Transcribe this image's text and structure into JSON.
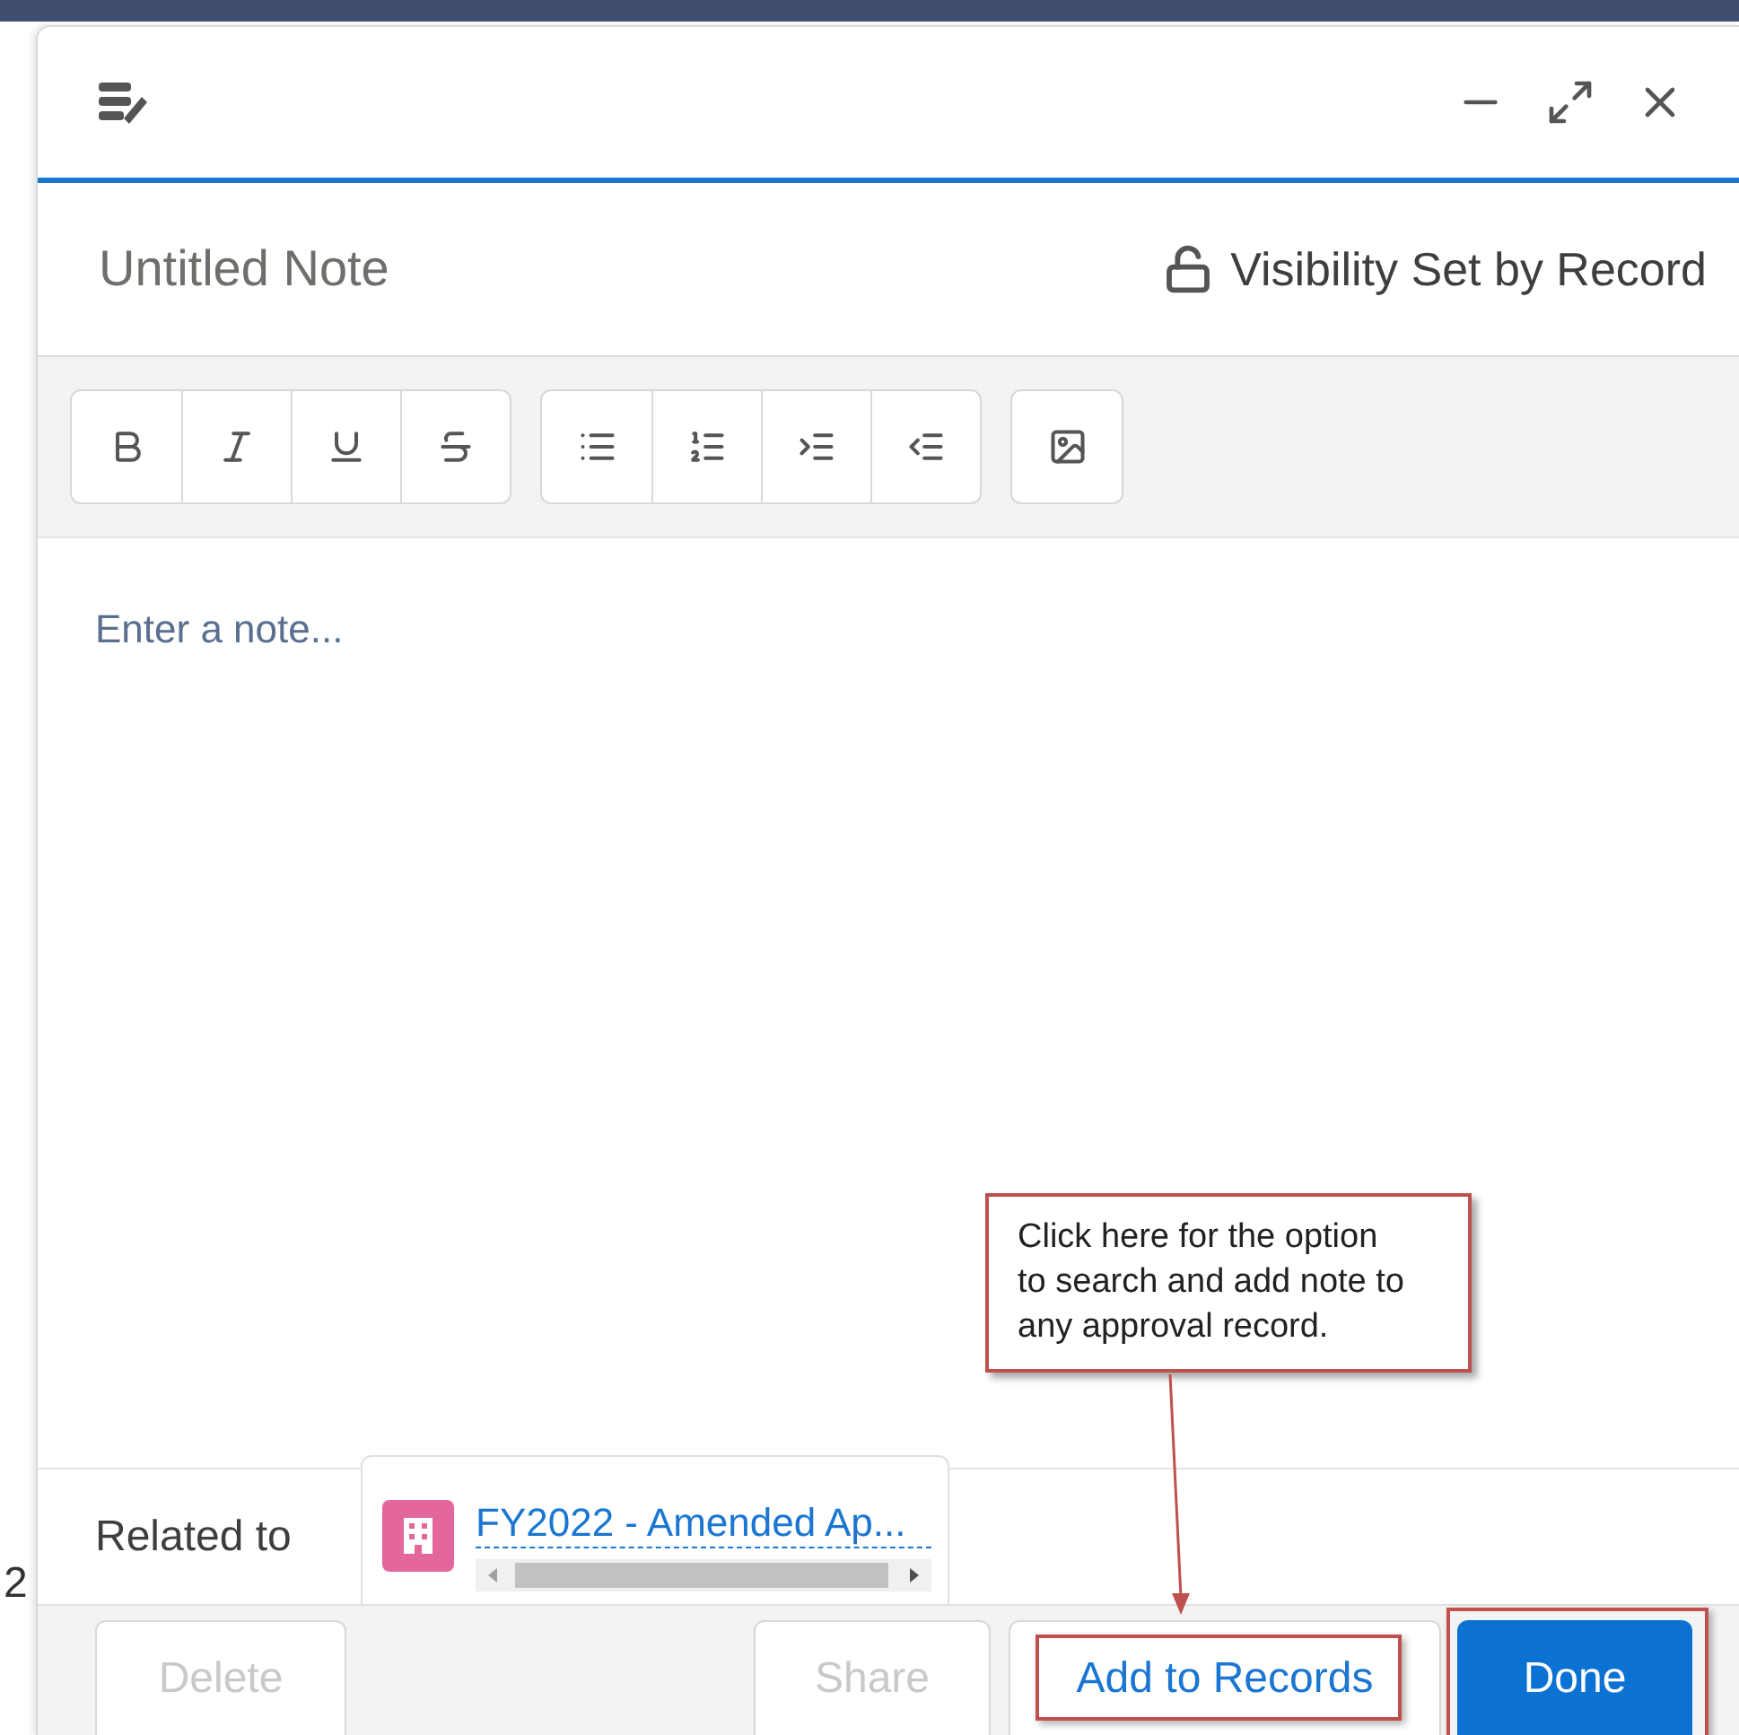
{
  "background": {
    "fragment": "2"
  },
  "window": {
    "controls": [
      {
        "kind": "minimize"
      },
      {
        "kind": "expand"
      },
      {
        "kind": "close"
      }
    ]
  },
  "note": {
    "title_placeholder": "Untitled Note",
    "visibility": "Visibility Set by Record",
    "body_placeholder": "Enter a note..."
  },
  "toolbar": {
    "groups": [
      [
        {
          "kind": "bold"
        },
        {
          "kind": "italic"
        },
        {
          "kind": "underline"
        },
        {
          "kind": "strikethrough"
        }
      ],
      [
        {
          "kind": "bullet-list"
        },
        {
          "kind": "numbered-list"
        },
        {
          "kind": "indent"
        },
        {
          "kind": "outdent"
        }
      ],
      [
        {
          "kind": "image"
        }
      ]
    ]
  },
  "related": {
    "label": "Related to",
    "record": "FY2022 - Amended Ap..."
  },
  "buttons": [
    {
      "label": "Delete",
      "kind": "neutral",
      "disabled": true
    },
    {
      "label": "Share",
      "kind": "neutral",
      "disabled": true
    },
    {
      "label": "Add to Records",
      "kind": "neutral",
      "disabled": false,
      "highlighted": true
    },
    {
      "label": "Done",
      "kind": "brand",
      "disabled": false,
      "highlighted": true
    }
  ],
  "callout": {
    "text": "Click here for the option to search and add note to any approval record."
  }
}
